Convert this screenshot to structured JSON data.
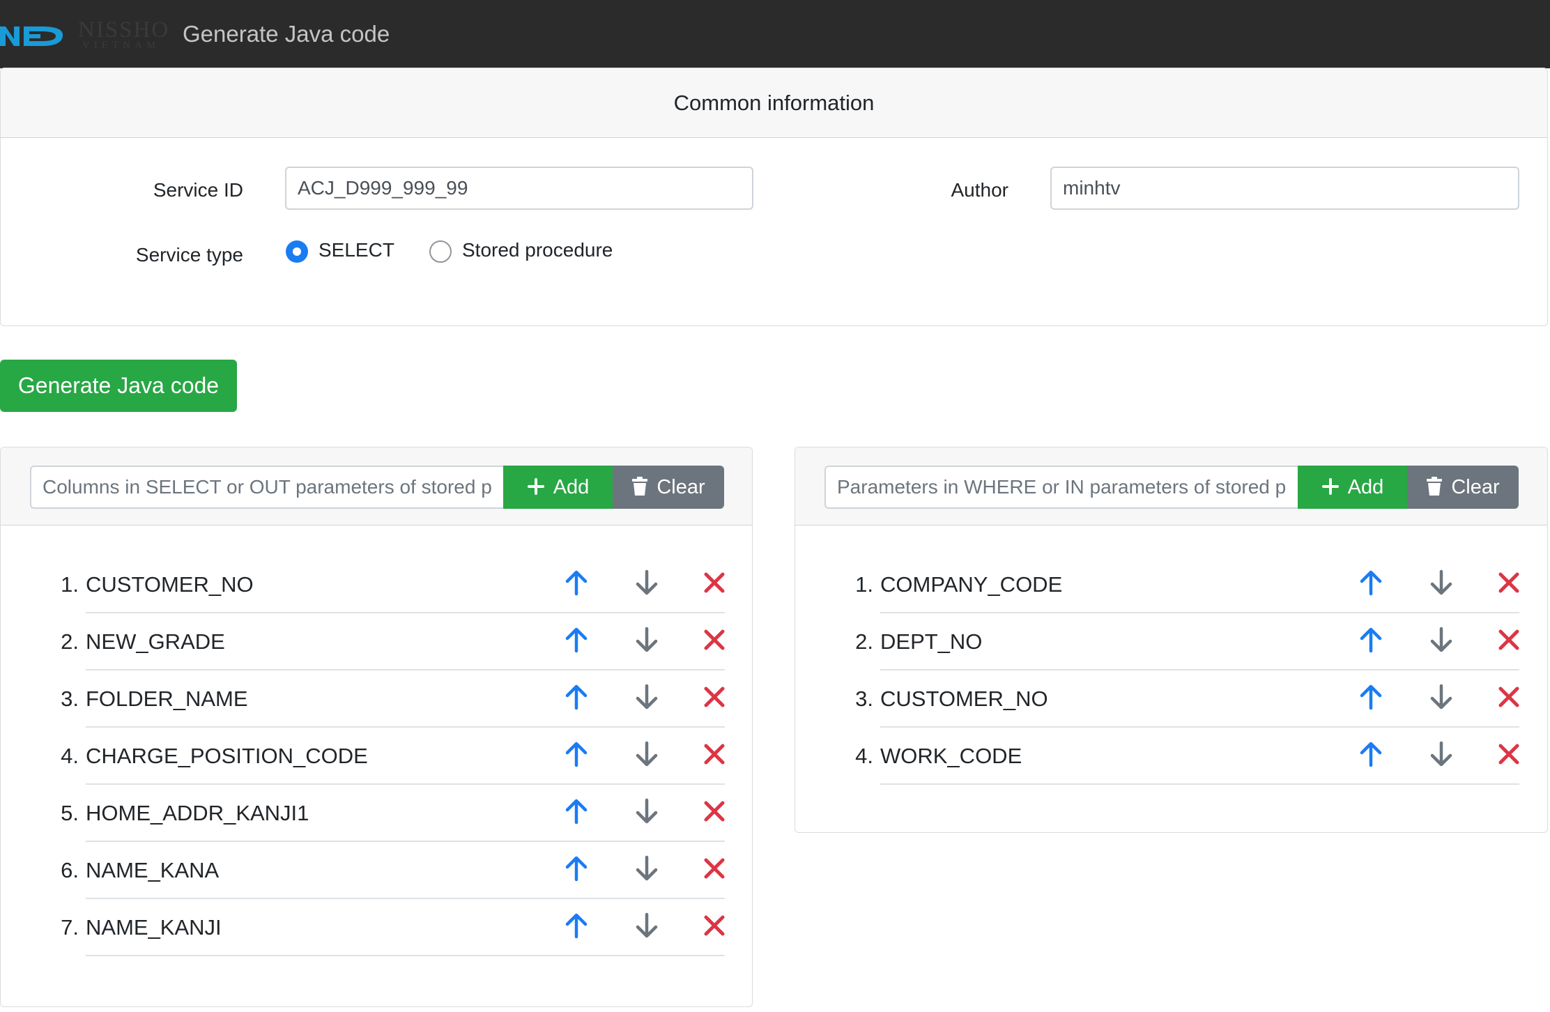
{
  "navbar": {
    "logo_text_line1": "NISSHO",
    "logo_text_line2": "VIETNAM",
    "title": "Generate Java code"
  },
  "common": {
    "header": "Common information",
    "service_id_label": "Service ID",
    "service_id_value": "ACJ_D999_999_99",
    "author_label": "Author",
    "author_value": "minhtv",
    "service_type_label": "Service type",
    "service_type_options": [
      "SELECT",
      "Stored procedure"
    ],
    "service_type_selected": "SELECT"
  },
  "generate_button": "Generate Java code",
  "left_panel": {
    "input_placeholder": "Columns in SELECT or OUT parameters of stored p",
    "add_label": "Add",
    "clear_label": "Clear",
    "items": [
      {
        "num": "1.",
        "name": "CUSTOMER_NO"
      },
      {
        "num": "2.",
        "name": "NEW_GRADE"
      },
      {
        "num": "3.",
        "name": "FOLDER_NAME"
      },
      {
        "num": "4.",
        "name": "CHARGE_POSITION_CODE"
      },
      {
        "num": "5.",
        "name": "HOME_ADDR_KANJI1"
      },
      {
        "num": "6.",
        "name": "NAME_KANA"
      },
      {
        "num": "7.",
        "name": "NAME_KANJI"
      }
    ]
  },
  "right_panel": {
    "input_placeholder": "Parameters in WHERE or IN parameters of stored p",
    "add_label": "Add",
    "clear_label": "Clear",
    "items": [
      {
        "num": "1.",
        "name": "COMPANY_CODE"
      },
      {
        "num": "2.",
        "name": "DEPT_NO"
      },
      {
        "num": "3.",
        "name": "CUSTOMER_NO"
      },
      {
        "num": "4.",
        "name": "WORK_CODE"
      }
    ]
  },
  "icons": {
    "move_up": "arrow-up-icon",
    "move_down": "arrow-down-icon",
    "remove": "x-icon",
    "add": "plus-icon",
    "clear": "trash-icon"
  },
  "colors": {
    "navbar": "#2b2b2b",
    "logo_blue": "#1a9ad6",
    "success": "#28a745",
    "secondary": "#6c757d",
    "primary": "#1a7cf2",
    "danger": "#dc3545"
  }
}
